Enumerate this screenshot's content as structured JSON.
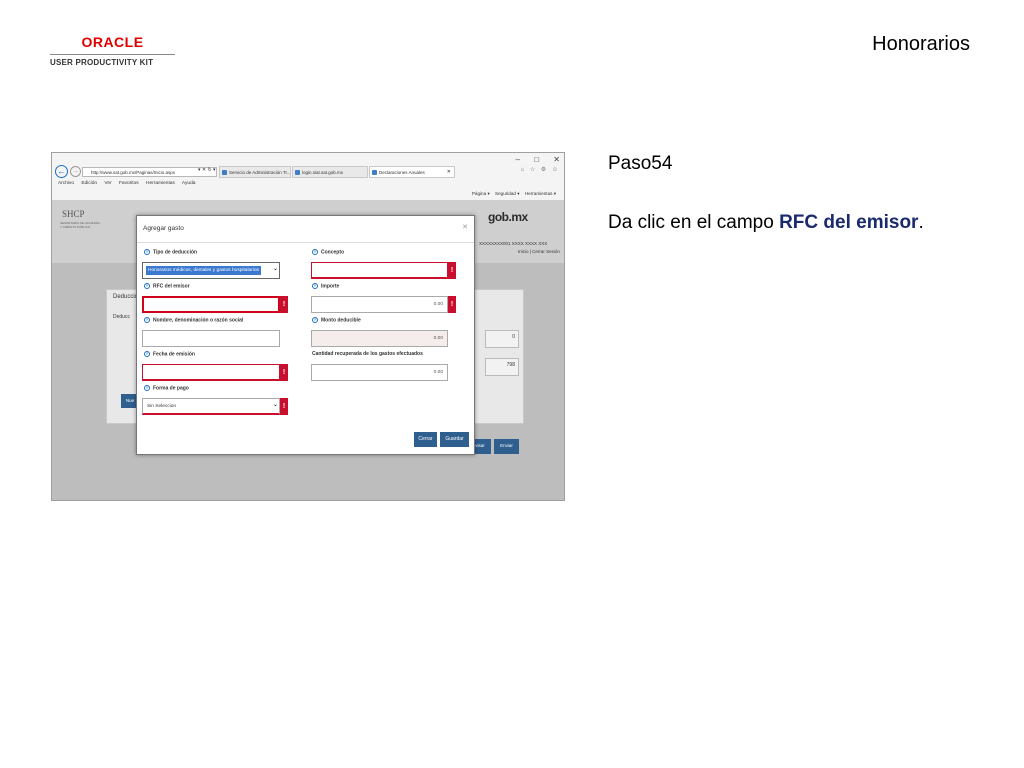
{
  "header": {
    "logo_brand": "ORACLE",
    "logo_product": "USER PRODUCTIVITY KIT",
    "title": "Honorarios"
  },
  "instruction": {
    "step": "Paso54",
    "text_before": "Da clic en el campo ",
    "target": "RFC del emisor",
    "text_after": "."
  },
  "browser": {
    "window_controls": [
      "–",
      "□",
      "✕"
    ],
    "address": "http://www.sat.gob.mx/Paginas/Inicio.aspx",
    "address_tools": "▾ ✕ ↻ ▾",
    "tabs": [
      {
        "label": "Servicio de Administración Tr...",
        "active": false
      },
      {
        "label": "login.siat.sat.gob.mx",
        "active": false
      },
      {
        "label": "Declaraciones Anuales",
        "active": true
      }
    ],
    "menu": [
      "Archivo",
      "Edición",
      "Ver",
      "Favoritos",
      "Herramientas",
      "Ayuda"
    ],
    "right_icons": [
      "⌂",
      "☆",
      "⚙",
      "☺"
    ],
    "command_bar": [
      "Página ▾",
      "Seguridad ▾",
      "Herramientas ▾"
    ]
  },
  "site": {
    "shcp": "SHCP",
    "shcp_sub": "SECRETARÍA DE HACIENDA Y CRÉDITO PÚBLICO",
    "gobmx": "gob.mx",
    "user": "XXXXXXXX001 XXXX XXXX XXX",
    "links": "Inicio | Cerrar Sesión",
    "panel_title": "Deduccio",
    "panel_radio": "Deducc",
    "values": [
      "0",
      "798"
    ],
    "nuevo_btn": "Nue",
    "revisar_btn": "visar",
    "enviar_btn": "Enviar"
  },
  "modal": {
    "title": "Agregar gasto",
    "close": "✕",
    "fields": {
      "tipo_label": "Tipo de deducción",
      "tipo_value": "Honorarios médicos, dentales y gastos hospitalarios",
      "concepto_label": "Concepto",
      "rfc_label": "RFC del emisor",
      "importe_label": "Importe",
      "importe_value": "0.00",
      "nombre_label": "Nombre, denominación o razón social",
      "monto_label": "Monto deducible",
      "monto_value": "0.00",
      "fecha_label": "Fecha de emisión",
      "cantidad_label": "Cantidad recuperada de los gastos efectuados",
      "cantidad_value": "0.00",
      "forma_label": "Forma de pago",
      "forma_value": "Sin Seleccion"
    },
    "error_mark": "!",
    "help_mark": "?",
    "caret": "⌄",
    "cerrar_btn": "Cerrar",
    "guardar_btn": "Guardar"
  },
  "colors": {
    "error": "#c8102e",
    "highlight": "#d0021b",
    "button": "#2f5f8f",
    "oracle_red": "#e00000"
  }
}
